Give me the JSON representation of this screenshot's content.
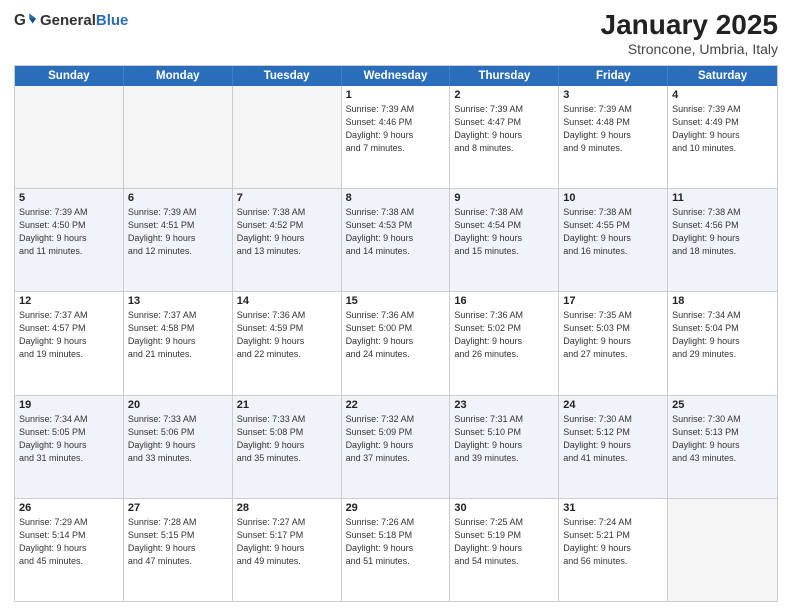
{
  "header": {
    "logo_general": "General",
    "logo_blue": "Blue",
    "title": "January 2025",
    "subtitle": "Stroncone, Umbria, Italy"
  },
  "calendar": {
    "weekdays": [
      "Sunday",
      "Monday",
      "Tuesday",
      "Wednesday",
      "Thursday",
      "Friday",
      "Saturday"
    ],
    "rows": [
      {
        "alt": false,
        "cells": [
          {
            "day": "",
            "info": ""
          },
          {
            "day": "",
            "info": ""
          },
          {
            "day": "",
            "info": ""
          },
          {
            "day": "1",
            "info": "Sunrise: 7:39 AM\nSunset: 4:46 PM\nDaylight: 9 hours\nand 7 minutes."
          },
          {
            "day": "2",
            "info": "Sunrise: 7:39 AM\nSunset: 4:47 PM\nDaylight: 9 hours\nand 8 minutes."
          },
          {
            "day": "3",
            "info": "Sunrise: 7:39 AM\nSunset: 4:48 PM\nDaylight: 9 hours\nand 9 minutes."
          },
          {
            "day": "4",
            "info": "Sunrise: 7:39 AM\nSunset: 4:49 PM\nDaylight: 9 hours\nand 10 minutes."
          }
        ]
      },
      {
        "alt": true,
        "cells": [
          {
            "day": "5",
            "info": "Sunrise: 7:39 AM\nSunset: 4:50 PM\nDaylight: 9 hours\nand 11 minutes."
          },
          {
            "day": "6",
            "info": "Sunrise: 7:39 AM\nSunset: 4:51 PM\nDaylight: 9 hours\nand 12 minutes."
          },
          {
            "day": "7",
            "info": "Sunrise: 7:38 AM\nSunset: 4:52 PM\nDaylight: 9 hours\nand 13 minutes."
          },
          {
            "day": "8",
            "info": "Sunrise: 7:38 AM\nSunset: 4:53 PM\nDaylight: 9 hours\nand 14 minutes."
          },
          {
            "day": "9",
            "info": "Sunrise: 7:38 AM\nSunset: 4:54 PM\nDaylight: 9 hours\nand 15 minutes."
          },
          {
            "day": "10",
            "info": "Sunrise: 7:38 AM\nSunset: 4:55 PM\nDaylight: 9 hours\nand 16 minutes."
          },
          {
            "day": "11",
            "info": "Sunrise: 7:38 AM\nSunset: 4:56 PM\nDaylight: 9 hours\nand 18 minutes."
          }
        ]
      },
      {
        "alt": false,
        "cells": [
          {
            "day": "12",
            "info": "Sunrise: 7:37 AM\nSunset: 4:57 PM\nDaylight: 9 hours\nand 19 minutes."
          },
          {
            "day": "13",
            "info": "Sunrise: 7:37 AM\nSunset: 4:58 PM\nDaylight: 9 hours\nand 21 minutes."
          },
          {
            "day": "14",
            "info": "Sunrise: 7:36 AM\nSunset: 4:59 PM\nDaylight: 9 hours\nand 22 minutes."
          },
          {
            "day": "15",
            "info": "Sunrise: 7:36 AM\nSunset: 5:00 PM\nDaylight: 9 hours\nand 24 minutes."
          },
          {
            "day": "16",
            "info": "Sunrise: 7:36 AM\nSunset: 5:02 PM\nDaylight: 9 hours\nand 26 minutes."
          },
          {
            "day": "17",
            "info": "Sunrise: 7:35 AM\nSunset: 5:03 PM\nDaylight: 9 hours\nand 27 minutes."
          },
          {
            "day": "18",
            "info": "Sunrise: 7:34 AM\nSunset: 5:04 PM\nDaylight: 9 hours\nand 29 minutes."
          }
        ]
      },
      {
        "alt": true,
        "cells": [
          {
            "day": "19",
            "info": "Sunrise: 7:34 AM\nSunset: 5:05 PM\nDaylight: 9 hours\nand 31 minutes."
          },
          {
            "day": "20",
            "info": "Sunrise: 7:33 AM\nSunset: 5:06 PM\nDaylight: 9 hours\nand 33 minutes."
          },
          {
            "day": "21",
            "info": "Sunrise: 7:33 AM\nSunset: 5:08 PM\nDaylight: 9 hours\nand 35 minutes."
          },
          {
            "day": "22",
            "info": "Sunrise: 7:32 AM\nSunset: 5:09 PM\nDaylight: 9 hours\nand 37 minutes."
          },
          {
            "day": "23",
            "info": "Sunrise: 7:31 AM\nSunset: 5:10 PM\nDaylight: 9 hours\nand 39 minutes."
          },
          {
            "day": "24",
            "info": "Sunrise: 7:30 AM\nSunset: 5:12 PM\nDaylight: 9 hours\nand 41 minutes."
          },
          {
            "day": "25",
            "info": "Sunrise: 7:30 AM\nSunset: 5:13 PM\nDaylight: 9 hours\nand 43 minutes."
          }
        ]
      },
      {
        "alt": false,
        "cells": [
          {
            "day": "26",
            "info": "Sunrise: 7:29 AM\nSunset: 5:14 PM\nDaylight: 9 hours\nand 45 minutes."
          },
          {
            "day": "27",
            "info": "Sunrise: 7:28 AM\nSunset: 5:15 PM\nDaylight: 9 hours\nand 47 minutes."
          },
          {
            "day": "28",
            "info": "Sunrise: 7:27 AM\nSunset: 5:17 PM\nDaylight: 9 hours\nand 49 minutes."
          },
          {
            "day": "29",
            "info": "Sunrise: 7:26 AM\nSunset: 5:18 PM\nDaylight: 9 hours\nand 51 minutes."
          },
          {
            "day": "30",
            "info": "Sunrise: 7:25 AM\nSunset: 5:19 PM\nDaylight: 9 hours\nand 54 minutes."
          },
          {
            "day": "31",
            "info": "Sunrise: 7:24 AM\nSunset: 5:21 PM\nDaylight: 9 hours\nand 56 minutes."
          },
          {
            "day": "",
            "info": ""
          }
        ]
      }
    ]
  }
}
